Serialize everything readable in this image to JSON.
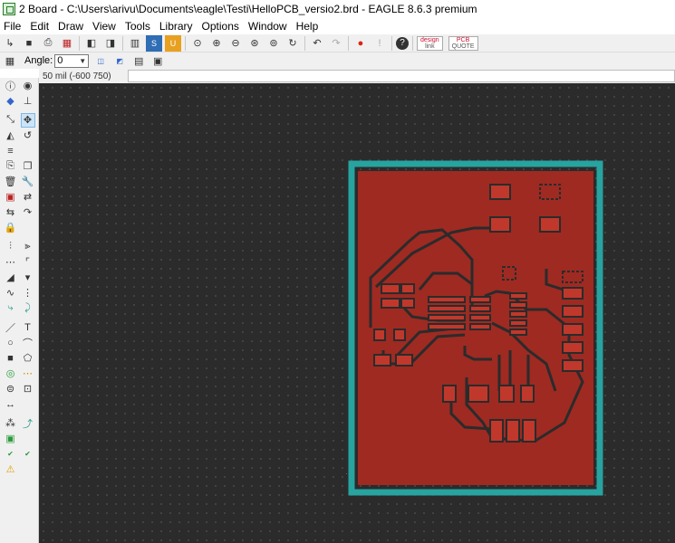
{
  "window": {
    "title": "2 Board - C:\\Users\\arivu\\Documents\\eagle\\Testi\\HelloPCB_versio2.brd - EAGLE 8.6.3 premium"
  },
  "menu": [
    "File",
    "Edit",
    "Draw",
    "View",
    "Tools",
    "Library",
    "Options",
    "Window",
    "Help"
  ],
  "toolbar": {
    "buttons": [
      {
        "name": "open-icon",
        "glyph": "↳"
      },
      {
        "name": "save-icon",
        "glyph": "■"
      },
      {
        "name": "print-icon",
        "glyph": "⎙"
      },
      {
        "name": "cam-icon",
        "glyph": "▦"
      },
      {
        "name": "schematic-switch-icon",
        "glyph": "◧"
      },
      {
        "name": "board-switch-icon",
        "glyph": "◨"
      },
      {
        "name": "library-icon",
        "glyph": "▥"
      },
      {
        "name": "script-icon",
        "glyph": "S"
      },
      {
        "name": "ulp-icon",
        "glyph": "U"
      },
      {
        "name": "zoom-fit-icon",
        "glyph": "⊙"
      },
      {
        "name": "zoom-in-icon",
        "glyph": "⊕"
      },
      {
        "name": "zoom-out-icon",
        "glyph": "⊖"
      },
      {
        "name": "zoom-window-icon",
        "glyph": "⊛"
      },
      {
        "name": "zoom-select-icon",
        "glyph": "⊚"
      },
      {
        "name": "redraw-icon",
        "glyph": "↻"
      },
      {
        "name": "undo-icon",
        "glyph": "↶"
      },
      {
        "name": "redo-icon",
        "glyph": "↷"
      },
      {
        "name": "stop-icon",
        "glyph": "⛔"
      },
      {
        "name": "go-icon",
        "glyph": "!"
      },
      {
        "name": "help-icon",
        "glyph": "?"
      }
    ],
    "design_link": {
      "line1": "design",
      "line2": "link"
    },
    "pcb_quote": {
      "line1": "PCB",
      "line2": "QUOTE"
    }
  },
  "toolbar2": {
    "angle_label": "Angle:",
    "angle_value": "0"
  },
  "command": {
    "coordinate": "50 mil (-600 750)",
    "input_value": ""
  },
  "colors": {
    "canvas": "#2b2b2b",
    "board_outline": "#27a3a0",
    "copper_top": "#9e2a22",
    "pad": "#c0382b"
  }
}
